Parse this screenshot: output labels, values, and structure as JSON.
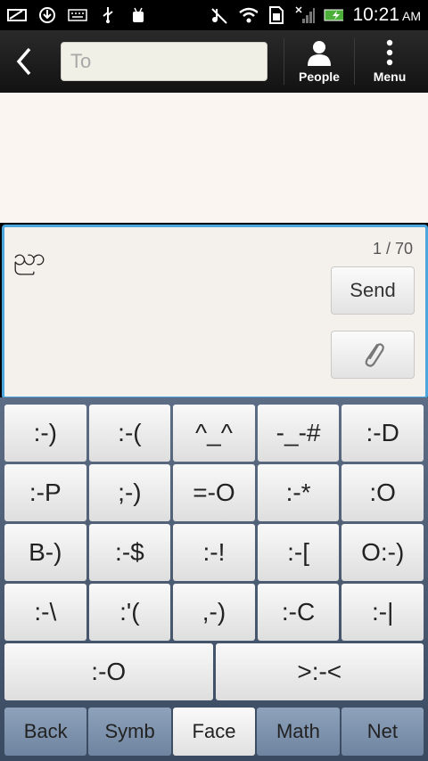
{
  "status_bar": {
    "time": "10:21",
    "ampm": "AM",
    "left_icons": [
      "message-icon",
      "download-icon",
      "keyboard-icon",
      "usb-icon",
      "android-debug-icon"
    ],
    "right_icons": [
      "mute-icon",
      "wifi-icon",
      "sim-icon",
      "no-signal-icon",
      "battery-charging-icon"
    ]
  },
  "header": {
    "to_placeholder": "To",
    "people_label": "People",
    "menu_label": "Menu"
  },
  "composer": {
    "message_text": "ညာ",
    "counter": "1 / 70",
    "send_label": "Send"
  },
  "keyboard": {
    "rows": [
      [
        ":-)",
        ":-(",
        "^_^",
        "-_-#",
        ":-D"
      ],
      [
        ":-P",
        ";-)",
        "=-O",
        ":-*",
        ":O"
      ],
      [
        "B-)",
        ":-$",
        ":-!",
        ":-[",
        "O:-)"
      ],
      [
        ":-\\",
        ":'(",
        ",-)",
        ":-C",
        ":-|"
      ],
      [
        ":-O",
        ">:-<"
      ]
    ],
    "tabs": [
      "Back",
      "Symb",
      "Face",
      "Math",
      "Net"
    ],
    "active_tab": "Face"
  },
  "colors": {
    "accent": "#4aa6dc",
    "keyboard_bg": "#4a5b73",
    "convo_bg": "#fbf5f1"
  }
}
